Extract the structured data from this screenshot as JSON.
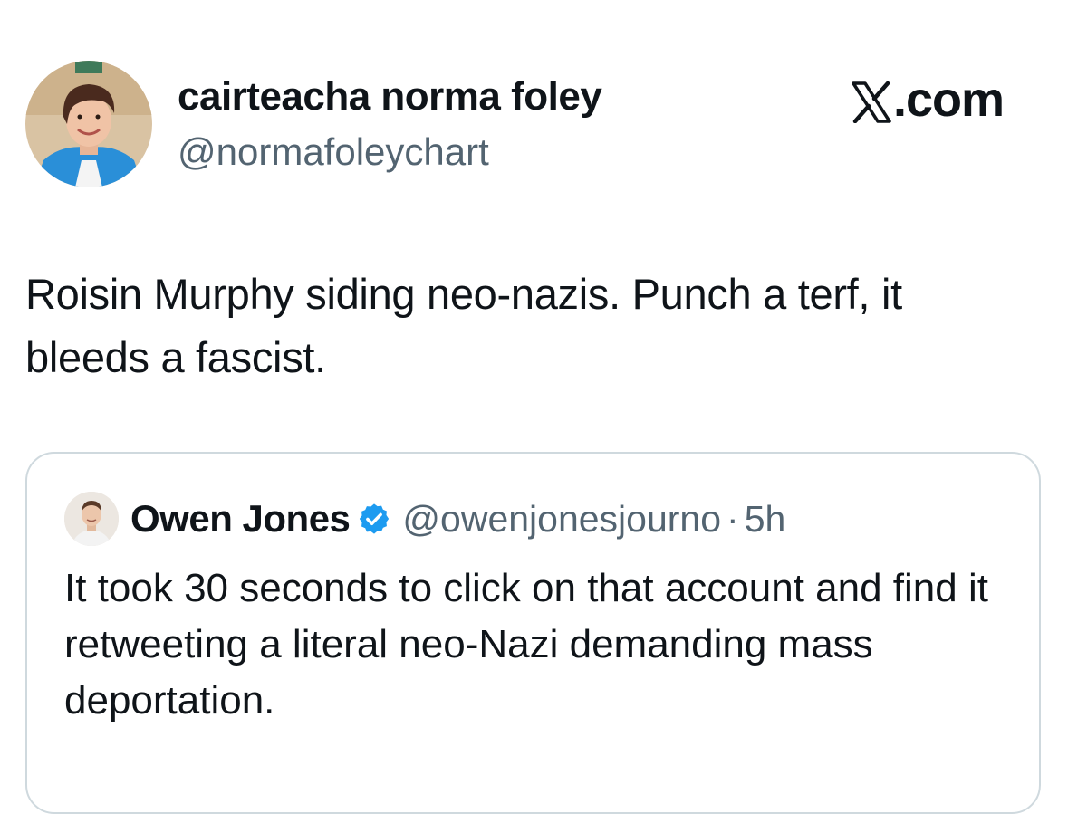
{
  "post": {
    "author": {
      "display_name": "cairteacha norma foley",
      "handle": "@normafoleychart"
    },
    "brand": "X.com",
    "brand_suffix": ".com",
    "text": "Roisin Murphy siding neo-nazis. Punch a terf, it bleeds a fascist."
  },
  "quote": {
    "author": {
      "display_name": "Owen Jones",
      "handle": "@owenjonesjourno",
      "verified": true
    },
    "separator": "·",
    "time": "5h",
    "text": "It took 30 seconds to click on that account and find it retweeting a literal neo-Nazi demanding mass deportation."
  },
  "colors": {
    "text_primary": "#0f1419",
    "text_secondary": "#536471",
    "verified_blue": "#1d9bf0",
    "card_border": "#cfd9de"
  },
  "icons": {
    "brand_logo": "x-logo-icon",
    "verified": "verified-badge-icon"
  }
}
